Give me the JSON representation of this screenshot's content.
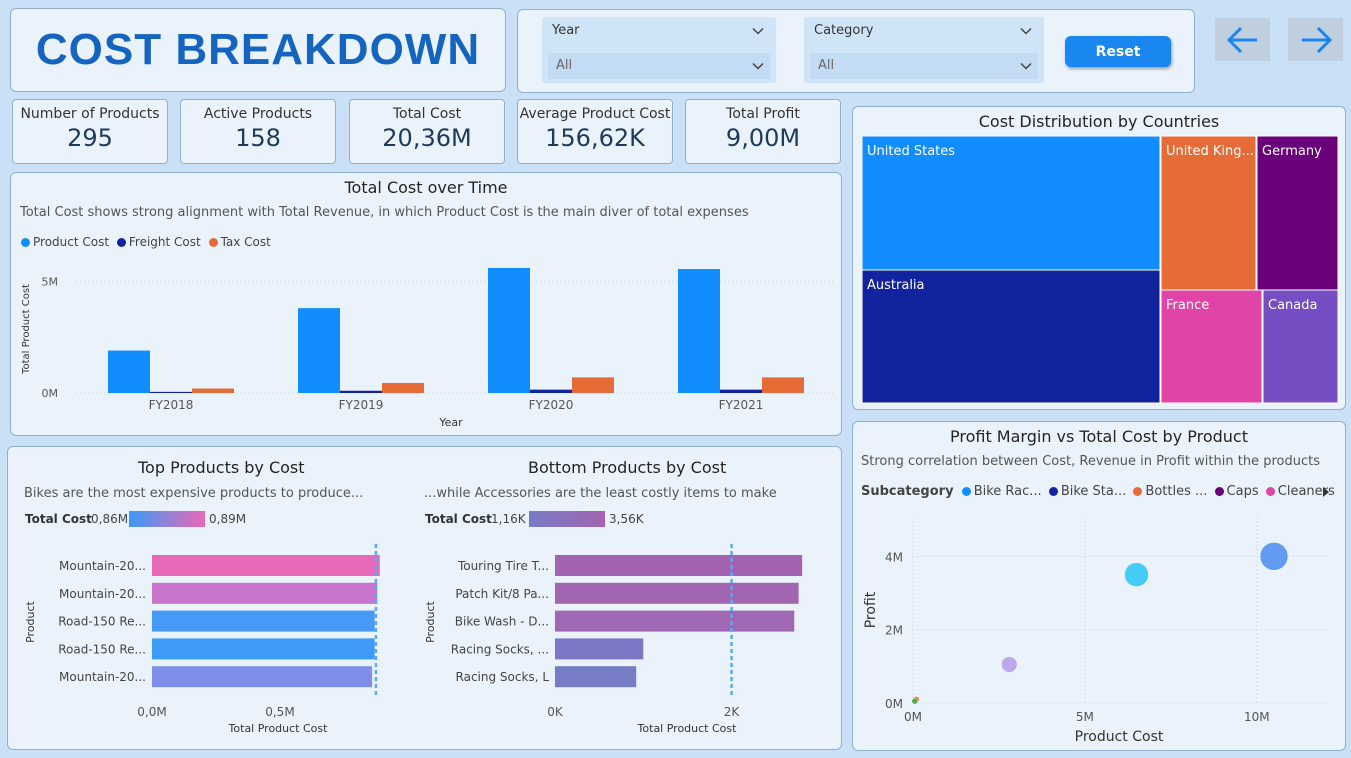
{
  "title": "COST BREAKDOWN",
  "filters": {
    "year": {
      "label": "Year",
      "value": "All"
    },
    "category": {
      "label": "Category",
      "value": "All"
    },
    "reset_label": "Reset"
  },
  "kpis": [
    {
      "label": "Number of Products",
      "value": "295"
    },
    {
      "label": "Active Products",
      "value": "158"
    },
    {
      "label": "Total Cost",
      "value": "20,36M"
    },
    {
      "label": "Average Product Cost",
      "value": "156,62K"
    },
    {
      "label": "Total Profit",
      "value": "9,00M"
    }
  ],
  "colors": {
    "accent": "#1a86f0",
    "product": "#118dff",
    "freight": "#12239e",
    "tax": "#e66c37"
  },
  "chart_data": [
    {
      "type": "bar",
      "title": "Total Cost over Time",
      "subtitle": "Total Cost shows strong alignment with Total Revenue, in which Product Cost is the main diver of total expenses",
      "categories": [
        "FY2018",
        "FY2019",
        "FY2020",
        "FY2021"
      ],
      "series": [
        {
          "name": "Product Cost",
          "color": "#118dff",
          "values": [
            1.9,
            3.8,
            5.6,
            5.55
          ]
        },
        {
          "name": "Freight Cost",
          "color": "#12239e",
          "values": [
            0.05,
            0.1,
            0.15,
            0.15
          ]
        },
        {
          "name": "Tax Cost",
          "color": "#e66c37",
          "values": [
            0.2,
            0.45,
            0.7,
            0.7
          ]
        }
      ],
      "xlabel": "Year",
      "ylabel": "Total Product Cost",
      "yticks": [
        "0M",
        "5M"
      ],
      "ylim": [
        0,
        6
      ]
    },
    {
      "type": "treemap",
      "title": "Cost Distribution by Countries",
      "items": [
        {
          "label": "United States",
          "color": "#118dff"
        },
        {
          "label": "Australia",
          "color": "#12239e"
        },
        {
          "label": "United King...",
          "color": "#e66c37"
        },
        {
          "label": "Germany",
          "color": "#6b007b"
        },
        {
          "label": "France",
          "color": "#e044a7"
        },
        {
          "label": "Canada",
          "color": "#744ec2"
        }
      ]
    },
    {
      "type": "bar",
      "title": "Top Products by Cost",
      "subtitle": "Bikes are the most expensive products to produce...",
      "legend_title": "Total Cost",
      "legend_min": "0,86M",
      "legend_max": "0,89M",
      "categories": [
        "Mountain-20...",
        "Mountain-20...",
        "Road-150 Re...",
        "Road-150 Re...",
        "Mountain-20..."
      ],
      "values": [
        0.89,
        0.88,
        0.87,
        0.87,
        0.86
      ],
      "colors": [
        "#e868b8",
        "#c873cc",
        "#4699f4",
        "#3d9af6",
        "#7f8ee8"
      ],
      "xlabel": "Total Product Cost",
      "ylabel": "Product",
      "xticks": [
        "0,0M",
        "0,5M"
      ],
      "xlim": [
        0,
        0.93
      ],
      "average": 0.875
    },
    {
      "type": "bar",
      "title": "Bottom Products by Cost",
      "subtitle": "...while Accessories are the least costly items to make",
      "legend_title": "Total Cost",
      "legend_min": "1,16K",
      "legend_max": "3,56K",
      "categories": [
        "Touring Tire T...",
        "Patch Kit/8 Pa...",
        "Bike Wash - D...",
        "Racing Socks, ...",
        "Racing Socks, L"
      ],
      "values": [
        2.8,
        2.76,
        2.71,
        1.0,
        0.92
      ],
      "colors": [
        "#a363b0",
        "#a265b0",
        "#a068b2",
        "#7a78c4",
        "#777cc6"
      ],
      "xlabel": "Total Product Cost",
      "ylabel": "Product",
      "xticks": [
        "0K",
        "2K"
      ],
      "xlim": [
        0,
        2.9
      ],
      "average": 2.0
    },
    {
      "type": "scatter",
      "title": "Profit Margin vs Total Cost by Product",
      "subtitle": "Strong correlation between Cost, Revenue in Profit within the products",
      "legend_title": "Subcategory",
      "legend": [
        {
          "name": "Bike Rac...",
          "color": "#118dff"
        },
        {
          "name": "Bike Sta...",
          "color": "#12239e"
        },
        {
          "name": "Bottles ...",
          "color": "#e66c37"
        },
        {
          "name": "Caps",
          "color": "#6b007b"
        },
        {
          "name": "Cleaners",
          "color": "#e044a7"
        }
      ],
      "points": [
        {
          "x": 10.5,
          "y": 4.0,
          "color": "#4a8bef",
          "size": 14
        },
        {
          "x": 6.5,
          "y": 3.5,
          "color": "#27c3f5",
          "size": 12
        },
        {
          "x": 2.8,
          "y": 1.05,
          "color": "#b59ae8",
          "size": 8
        },
        {
          "x": 0.1,
          "y": 0.1,
          "color": "#e66c37",
          "size": 3
        },
        {
          "x": 0.05,
          "y": 0.05,
          "color": "#3fa43f",
          "size": 3
        }
      ],
      "xlabel": "Product Cost",
      "ylabel": "Profit",
      "xticks": [
        "0M",
        "5M",
        "10M"
      ],
      "yticks": [
        "0M",
        "2M",
        "4M"
      ],
      "xlim": [
        0,
        12.1
      ],
      "ylim": [
        0,
        4.8
      ]
    }
  ]
}
